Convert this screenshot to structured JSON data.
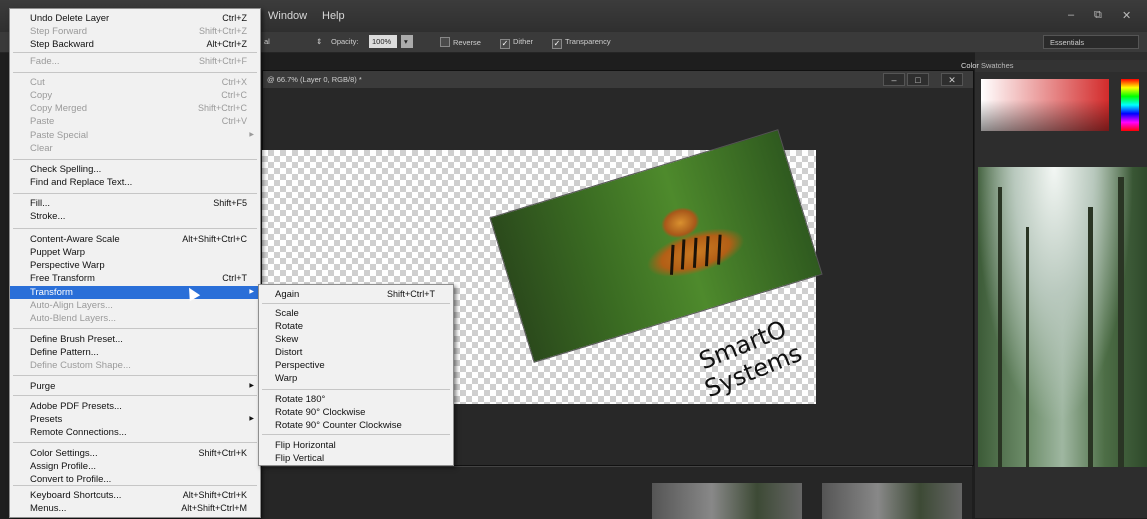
{
  "app": {
    "menubar": [
      "Window",
      "Help"
    ],
    "window_controls": [
      "–",
      "⧉",
      "✕"
    ]
  },
  "options_bar": {
    "mode_value": "al",
    "opacity_label": "Opacity:",
    "opacity_value": "100%",
    "reverse_label": "Reverse",
    "dither_label": "Dither",
    "transparency_label": "Transparency",
    "workspace": "Essentials"
  },
  "document": {
    "tab_title": "@ 66.7% (Layer 0, RGB/8) *",
    "canvas_text_line1": "SmartO",
    "canvas_text_line2": "Systems"
  },
  "right_panel": {
    "tabs": [
      "Color",
      "Swatches"
    ]
  },
  "edit_menu": {
    "items": [
      {
        "label": "Undo Delete Layer",
        "shortcut": "Ctrl+Z",
        "enabled": true
      },
      {
        "label": "Step Forward",
        "shortcut": "Shift+Ctrl+Z",
        "enabled": false
      },
      {
        "label": "Step Backward",
        "shortcut": "Alt+Ctrl+Z",
        "enabled": true
      },
      {
        "label": "Fade...",
        "shortcut": "Shift+Ctrl+F",
        "enabled": false
      },
      {
        "label": "Cut",
        "shortcut": "Ctrl+X",
        "enabled": false
      },
      {
        "label": "Copy",
        "shortcut": "Ctrl+C",
        "enabled": false
      },
      {
        "label": "Copy Merged",
        "shortcut": "Shift+Ctrl+C",
        "enabled": false
      },
      {
        "label": "Paste",
        "shortcut": "Ctrl+V",
        "enabled": false
      },
      {
        "label": "Paste Special",
        "shortcut": "",
        "enabled": false,
        "submenu": true
      },
      {
        "label": "Clear",
        "shortcut": "",
        "enabled": false
      },
      {
        "label": "Check Spelling...",
        "shortcut": "",
        "enabled": true
      },
      {
        "label": "Find and Replace Text...",
        "shortcut": "",
        "enabled": true
      },
      {
        "label": "Fill...",
        "shortcut": "Shift+F5",
        "enabled": true
      },
      {
        "label": "Stroke...",
        "shortcut": "",
        "enabled": true
      },
      {
        "label": "Content-Aware Scale",
        "shortcut": "Alt+Shift+Ctrl+C",
        "enabled": true
      },
      {
        "label": "Puppet Warp",
        "shortcut": "",
        "enabled": true
      },
      {
        "label": "Perspective Warp",
        "shortcut": "",
        "enabled": true
      },
      {
        "label": "Free Transform",
        "shortcut": "Ctrl+T",
        "enabled": true
      },
      {
        "label": "Transform",
        "shortcut": "",
        "enabled": true,
        "submenu": true,
        "highlighted": true
      },
      {
        "label": "Auto-Align Layers...",
        "shortcut": "",
        "enabled": false
      },
      {
        "label": "Auto-Blend Layers...",
        "shortcut": "",
        "enabled": false
      },
      {
        "label": "Define Brush Preset...",
        "shortcut": "",
        "enabled": true
      },
      {
        "label": "Define Pattern...",
        "shortcut": "",
        "enabled": true
      },
      {
        "label": "Define Custom Shape...",
        "shortcut": "",
        "enabled": false
      },
      {
        "label": "Purge",
        "shortcut": "",
        "enabled": true,
        "submenu": true
      },
      {
        "label": "Adobe PDF Presets...",
        "shortcut": "",
        "enabled": true
      },
      {
        "label": "Presets",
        "shortcut": "",
        "enabled": true,
        "submenu": true
      },
      {
        "label": "Remote Connections...",
        "shortcut": "",
        "enabled": true
      },
      {
        "label": "Color Settings...",
        "shortcut": "Shift+Ctrl+K",
        "enabled": true
      },
      {
        "label": "Assign Profile...",
        "shortcut": "",
        "enabled": true
      },
      {
        "label": "Convert to Profile...",
        "shortcut": "",
        "enabled": true
      },
      {
        "label": "Keyboard Shortcuts...",
        "shortcut": "Alt+Shift+Ctrl+K",
        "enabled": true
      },
      {
        "label": "Menus...",
        "shortcut": "Alt+Shift+Ctrl+M",
        "enabled": true
      }
    ]
  },
  "transform_submenu": {
    "items": [
      {
        "label": "Again",
        "shortcut": "Shift+Ctrl+T"
      },
      {
        "label": "Scale",
        "shortcut": ""
      },
      {
        "label": "Rotate",
        "shortcut": ""
      },
      {
        "label": "Skew",
        "shortcut": ""
      },
      {
        "label": "Distort",
        "shortcut": ""
      },
      {
        "label": "Perspective",
        "shortcut": ""
      },
      {
        "label": "Warp",
        "shortcut": ""
      },
      {
        "label": "Rotate 180°",
        "shortcut": ""
      },
      {
        "label": "Rotate 90° Clockwise",
        "shortcut": ""
      },
      {
        "label": "Rotate 90° Counter Clockwise",
        "shortcut": ""
      },
      {
        "label": "Flip Horizontal",
        "shortcut": ""
      },
      {
        "label": "Flip Vertical",
        "shortcut": ""
      }
    ]
  },
  "colors": {
    "menu_highlight": "#2a6fd8",
    "menu_bg": "#f1f1f1",
    "disabled_text": "#9a9a9a",
    "app_bg": "#1e1e1e"
  }
}
